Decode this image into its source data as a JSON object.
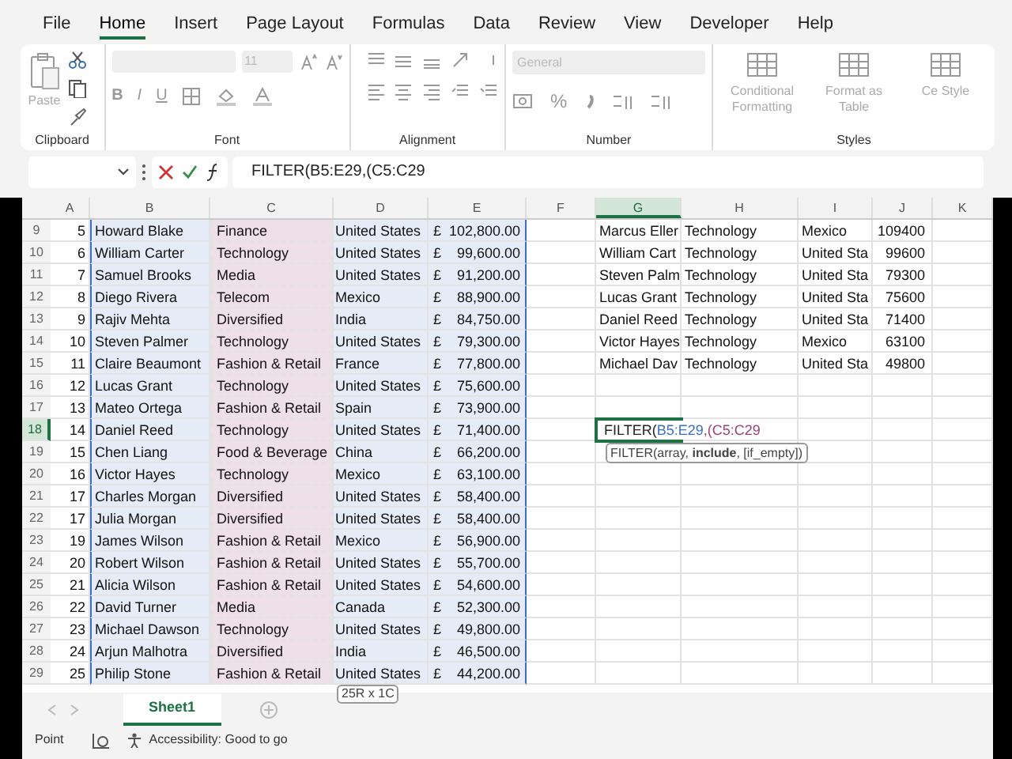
{
  "menu_tabs": [
    {
      "label": "File",
      "selected": false
    },
    {
      "label": "Home",
      "selected": true
    },
    {
      "label": "Insert",
      "selected": false
    },
    {
      "label": "Page Layout",
      "selected": false
    },
    {
      "label": "Formulas",
      "selected": false
    },
    {
      "label": "Data",
      "selected": false
    },
    {
      "label": "Review",
      "selected": false
    },
    {
      "label": "View",
      "selected": false
    },
    {
      "label": "Developer",
      "selected": false
    },
    {
      "label": "Help",
      "selected": false
    }
  ],
  "ribbon": {
    "clipboard": {
      "label": "Clipboard",
      "paste": "Paste"
    },
    "font": {
      "label": "Font",
      "size": "11",
      "bold": "B",
      "italic": "I",
      "underline": "U"
    },
    "alignment": {
      "label": "Alignment"
    },
    "number": {
      "label": "Number",
      "format": "General",
      "percent": "%"
    },
    "styles": {
      "label": "Styles",
      "buttons": [
        "Conditional Formatting",
        "Format as Table",
        "Ce Style"
      ]
    }
  },
  "formula_bar": {
    "formula": "FILTER(B5:E29,(C5:C29"
  },
  "columns": [
    {
      "label": "A",
      "selected": false
    },
    {
      "label": "B",
      "selected": false
    },
    {
      "label": "C",
      "selected": false
    },
    {
      "label": "D",
      "selected": false
    },
    {
      "label": "E",
      "selected": false
    },
    {
      "label": "F",
      "selected": false
    },
    {
      "label": "G",
      "selected": true
    },
    {
      "label": "H",
      "selected": false
    },
    {
      "label": "I",
      "selected": false
    },
    {
      "label": "J",
      "selected": false
    },
    {
      "label": "K",
      "selected": false
    }
  ],
  "rows": [
    {
      "row": "9",
      "selected": false,
      "num": "5",
      "name": "Howard Blake",
      "industry": "Finance",
      "country": "United States",
      "currency": "£",
      "amount": "102,800.00",
      "result": [
        "Marcus Eller",
        "Technology",
        "Mexico",
        "109400"
      ]
    },
    {
      "row": "10",
      "selected": false,
      "num": "6",
      "name": "William Carter",
      "industry": "Technology",
      "country": "United States",
      "currency": "£",
      "amount": "99,600.00",
      "result": [
        "William Cart",
        "Technology",
        "United Sta",
        "99600"
      ]
    },
    {
      "row": "11",
      "selected": false,
      "num": "7",
      "name": "Samuel Brooks",
      "industry": "Media",
      "country": "United States",
      "currency": "£",
      "amount": "91,200.00",
      "result": [
        "Steven Palm",
        "Technology",
        "United Sta",
        "79300"
      ]
    },
    {
      "row": "12",
      "selected": false,
      "num": "8",
      "name": "Diego Rivera",
      "industry": "Telecom",
      "country": "Mexico",
      "currency": "£",
      "amount": "88,900.00",
      "result": [
        "Lucas Grant",
        "Technology",
        "United Sta",
        "75600"
      ]
    },
    {
      "row": "13",
      "selected": false,
      "num": "9",
      "name": "Rajiv Mehta",
      "industry": "Diversified",
      "country": "India",
      "currency": "£",
      "amount": "84,750.00",
      "result": [
        "Daniel Reed",
        "Technology",
        "United Sta",
        "71400"
      ]
    },
    {
      "row": "14",
      "selected": false,
      "num": "10",
      "name": "Steven Palmer",
      "industry": "Technology",
      "country": "United States",
      "currency": "£",
      "amount": "79,300.00",
      "result": [
        "Victor Hayes",
        "Technology",
        "Mexico",
        "63100"
      ]
    },
    {
      "row": "15",
      "selected": false,
      "num": "11",
      "name": "Claire Beaumont",
      "industry": "Fashion & Retail",
      "country": "France",
      "currency": "£",
      "amount": "77,800.00",
      "result": [
        "Michael Dav",
        "Technology",
        "United Sta",
        "49800"
      ]
    },
    {
      "row": "16",
      "selected": false,
      "num": "12",
      "name": "Lucas Grant",
      "industry": "Technology",
      "country": "United States",
      "currency": "£",
      "amount": "75,600.00"
    },
    {
      "row": "17",
      "selected": false,
      "num": "13",
      "name": "Mateo Ortega",
      "industry": "Fashion & Retail",
      "country": "Spain",
      "currency": "£",
      "amount": "73,900.00"
    },
    {
      "row": "18",
      "selected": true,
      "num": "14",
      "name": "Daniel Reed",
      "industry": "Technology",
      "country": "United States",
      "currency": "£",
      "amount": "71,400.00"
    },
    {
      "row": "19",
      "selected": false,
      "num": "15",
      "name": "Chen Liang",
      "industry": "Food & Beverage",
      "country": "China",
      "currency": "£",
      "amount": "66,200.00"
    },
    {
      "row": "20",
      "selected": false,
      "num": "16",
      "name": "Victor Hayes",
      "industry": "Technology",
      "country": "Mexico",
      "currency": "£",
      "amount": "63,100.00"
    },
    {
      "row": "21",
      "selected": false,
      "num": "17",
      "name": "Charles Morgan",
      "industry": "Diversified",
      "country": "United States",
      "currency": "£",
      "amount": "58,400.00"
    },
    {
      "row": "22",
      "selected": false,
      "num": "17",
      "name": "Julia Morgan",
      "industry": "Diversified",
      "country": "United States",
      "currency": "£",
      "amount": "58,400.00"
    },
    {
      "row": "23",
      "selected": false,
      "num": "19",
      "name": "James Wilson",
      "industry": "Fashion & Retail",
      "country": "Mexico",
      "currency": "£",
      "amount": "56,900.00"
    },
    {
      "row": "24",
      "selected": false,
      "num": "20",
      "name": "Robert Wilson",
      "industry": "Fashion & Retail",
      "country": "United States",
      "currency": "£",
      "amount": "55,700.00"
    },
    {
      "row": "25",
      "selected": false,
      "num": "21",
      "name": "Alicia Wilson",
      "industry": "Fashion & Retail",
      "country": "United States",
      "currency": "£",
      "amount": "54,600.00"
    },
    {
      "row": "26",
      "selected": false,
      "num": "22",
      "name": "David Turner",
      "industry": "Media",
      "country": "Canada",
      "currency": "£",
      "amount": "52,300.00"
    },
    {
      "row": "27",
      "selected": false,
      "num": "23",
      "name": "Michael Dawson",
      "industry": "Technology",
      "country": "United States",
      "currency": "£",
      "amount": "49,800.00"
    },
    {
      "row": "28",
      "selected": false,
      "num": "24",
      "name": "Arjun Malhotra",
      "industry": "Diversified",
      "country": "India",
      "currency": "£",
      "amount": "46,500.00"
    },
    {
      "row": "29",
      "selected": false,
      "num": "25",
      "name": "Philip Stone",
      "industry": "Fashion & Retail",
      "country": "United States",
      "currency": "£",
      "amount": "44,200.00"
    }
  ],
  "edit_cell": {
    "parts": [
      {
        "text": "FILTER(",
        "color": "#222222"
      },
      {
        "text": "B5:E29",
        "color": "#3b6fc4"
      },
      {
        "text": ",(C5:C29",
        "color": "#a0407a"
      }
    ],
    "tooltip": "FILTER(array, **include**, [if_empty])"
  },
  "selection_size": "25R x 1C",
  "sheet_tabs": [
    {
      "label": "Sheet1",
      "selected": true
    }
  ],
  "status_bar": {
    "mode": "Point",
    "accessibility": "Accessibility: Good to go"
  }
}
